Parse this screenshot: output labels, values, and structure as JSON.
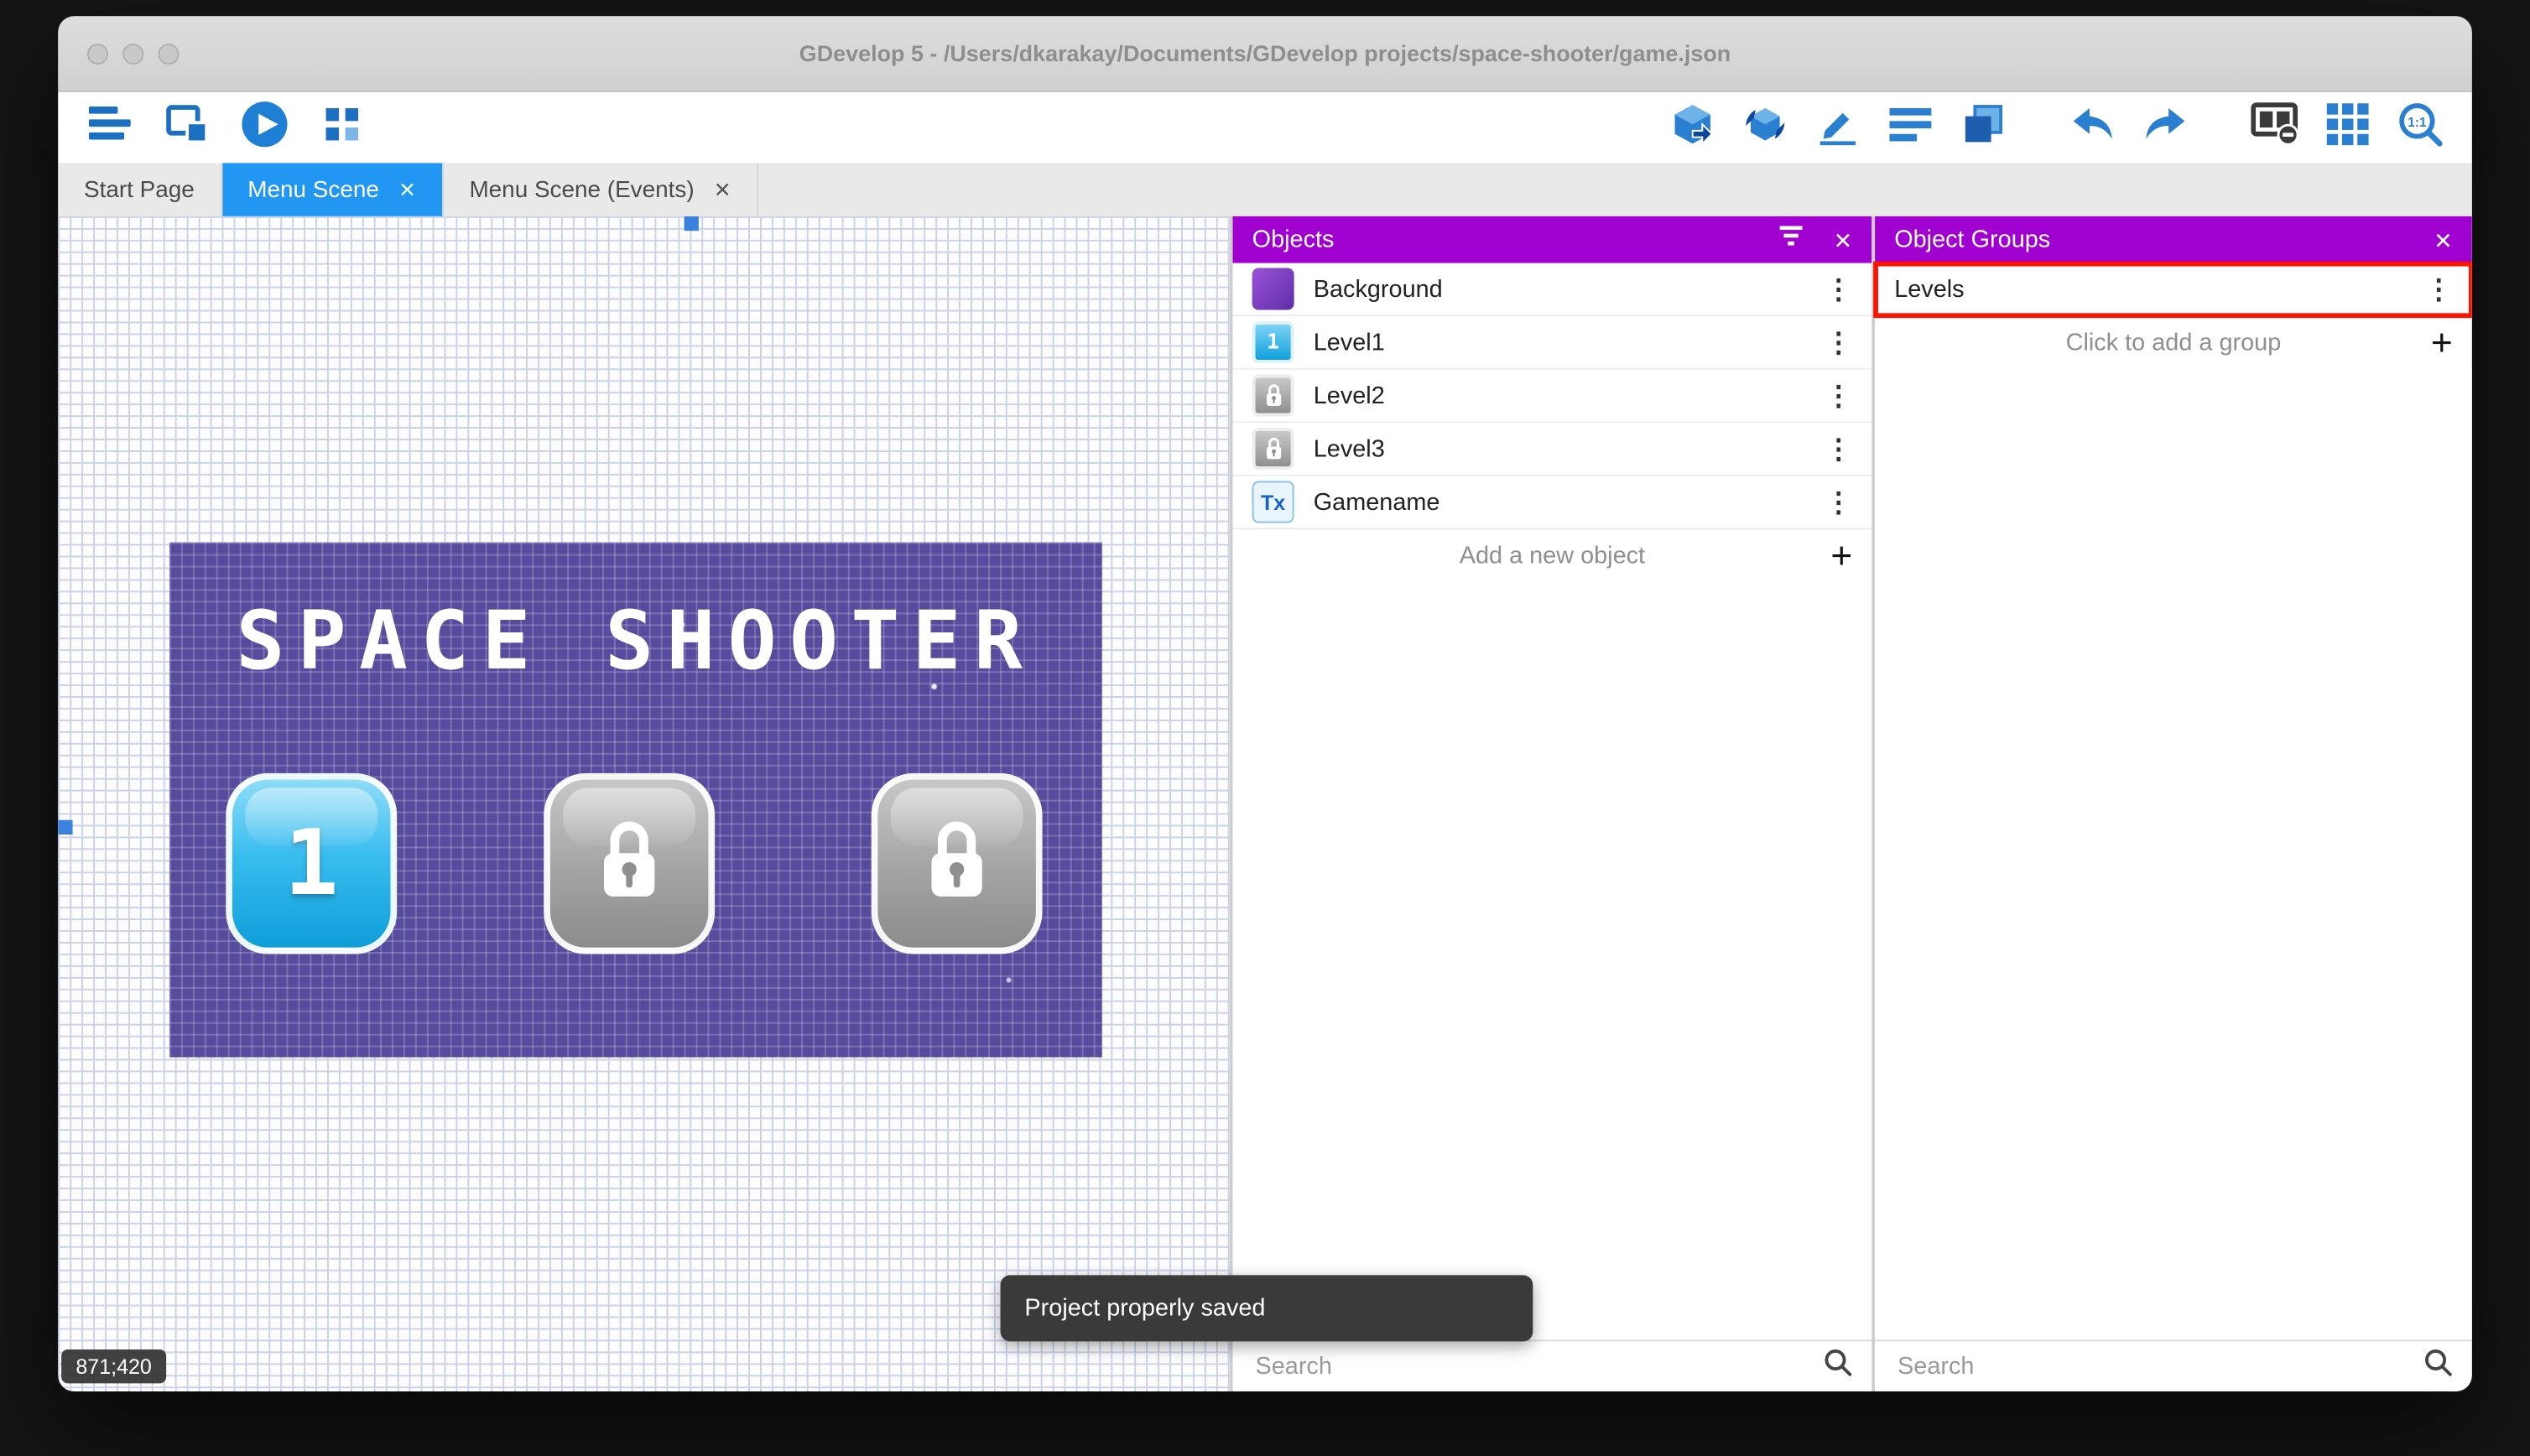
{
  "window": {
    "title": "GDevelop 5 - /Users/dkarakay/Documents/GDevelop projects/space-shooter/game.json"
  },
  "toolbar": {
    "zoom_label": "1:1"
  },
  "tabs": [
    {
      "label": "Start Page"
    },
    {
      "label": "Menu Scene"
    },
    {
      "label": "Menu Scene (Events)"
    }
  ],
  "glyphs": {
    "close": "✕",
    "kebab": "⋮",
    "plus": "+"
  },
  "canvas": {
    "scene_title": "SPACE SHOOTER",
    "level1_label": "1",
    "coordinates": "871;420"
  },
  "toast": {
    "message": "Project properly saved"
  },
  "objects_panel": {
    "title": "Objects",
    "items": [
      {
        "name": "Background"
      },
      {
        "name": "Level1",
        "thumb_label": "1"
      },
      {
        "name": "Level2"
      },
      {
        "name": "Level3"
      },
      {
        "name": "Gamename",
        "thumb_label": "Tx"
      }
    ],
    "add_label": "Add a new object",
    "search_placeholder": "Search"
  },
  "groups_panel": {
    "title": "Object Groups",
    "items": [
      {
        "name": "Levels"
      }
    ],
    "add_label": "Click to add a group",
    "search_placeholder": "Search"
  }
}
